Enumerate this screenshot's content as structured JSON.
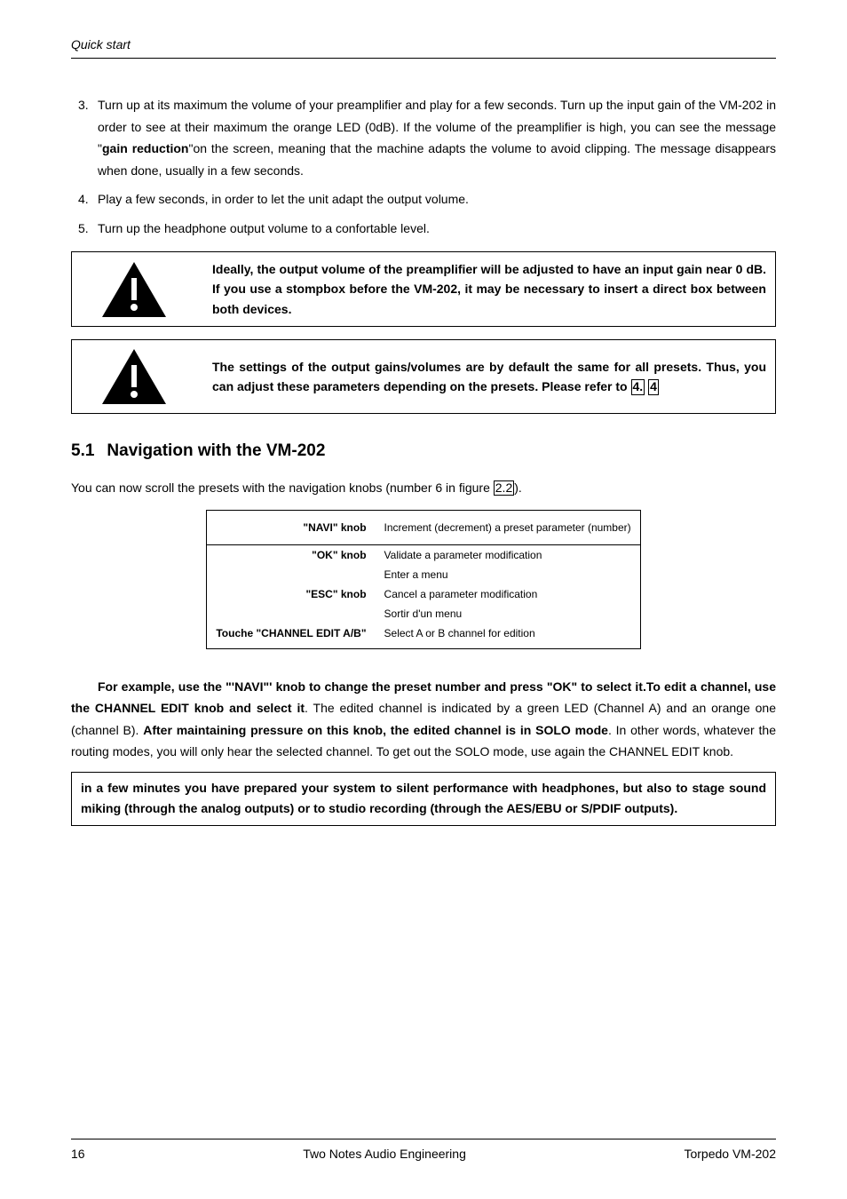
{
  "header": {
    "title": "Quick start"
  },
  "list": {
    "item3": {
      "num": "3.",
      "text_a": "Turn up at its maximum the volume of your preamplifier and play for a few seconds. Turn up the input gain of the VM-202 in order to see at their maximum the orange LED (0dB). If the volume of the preamplifier is high, you can see the message \"",
      "text_b": "gain reduction",
      "text_c": "\"on the screen, meaning that the machine adapts the volume to avoid clipping. The message disappears when done, usually in a few seconds."
    },
    "item4": {
      "num": "4.",
      "text": "Play a few seconds, in order to let the unit adapt the output volume."
    },
    "item5": {
      "num": "5.",
      "text": "Turn up the headphone output volume to a confortable level."
    }
  },
  "warning1": "Ideally, the output volume of the preamplifier will be adjusted to have an input gain near 0 dB. If you use a stompbox before the VM-202, it may be necessary to insert a direct box between both devices.",
  "warning2": {
    "a": "The settings of the output gains/volumes are by default the same for all presets. Thus, you can adjust these parameters depending on the presets. Please refer to ",
    "ref1": "4.",
    "ref2": "4"
  },
  "section": {
    "num": "5.1",
    "title": "Navigation with the VM-202"
  },
  "intro": {
    "a": "You can now scroll the presets with the navigation knobs (number 6 in figure ",
    "ref": "2.2",
    "b": ")."
  },
  "table": {
    "r1": {
      "label": "\"NAVI\" knob",
      "desc": "Increment (decrement) a preset parameter (number)"
    },
    "r2": {
      "label": "\"OK\" knob",
      "desc1": "Validate a parameter modification",
      "desc2": "Enter a menu"
    },
    "r3": {
      "label": "\"ESC\" knob",
      "desc1": "Cancel a parameter modification",
      "desc2": "Sortir d'un menu"
    },
    "r4": {
      "label": "Touche \"CHANNEL EDIT A/B\"",
      "desc": "Select A or B channel for edition"
    }
  },
  "para": {
    "a": "For example, use the \"'NAVI\"' knob to change the preset number and press \"OK\" to select it.",
    "b": "To edit a channel, use the CHANNEL EDIT knob and select it",
    "c": ". The edited channel is indicated by a green LED (Channel A) and an orange one (channel B). ",
    "d": "After maintaining pressure on this knob, the edited channel is in SOLO mode",
    "e": ". In other words, whatever the routing modes, you will only hear the selected channel. To get out the SOLO mode, use again the CHANNEL EDIT knob."
  },
  "summary": "in a few minutes you have prepared your system to silent performance with headphones, but also to stage sound miking (through the analog outputs) or to studio recording (through the AES/EBU or S/PDIF outputs).",
  "footer": {
    "page": "16",
    "center": "Two Notes Audio Engineering",
    "right": "Torpedo VM-202"
  }
}
